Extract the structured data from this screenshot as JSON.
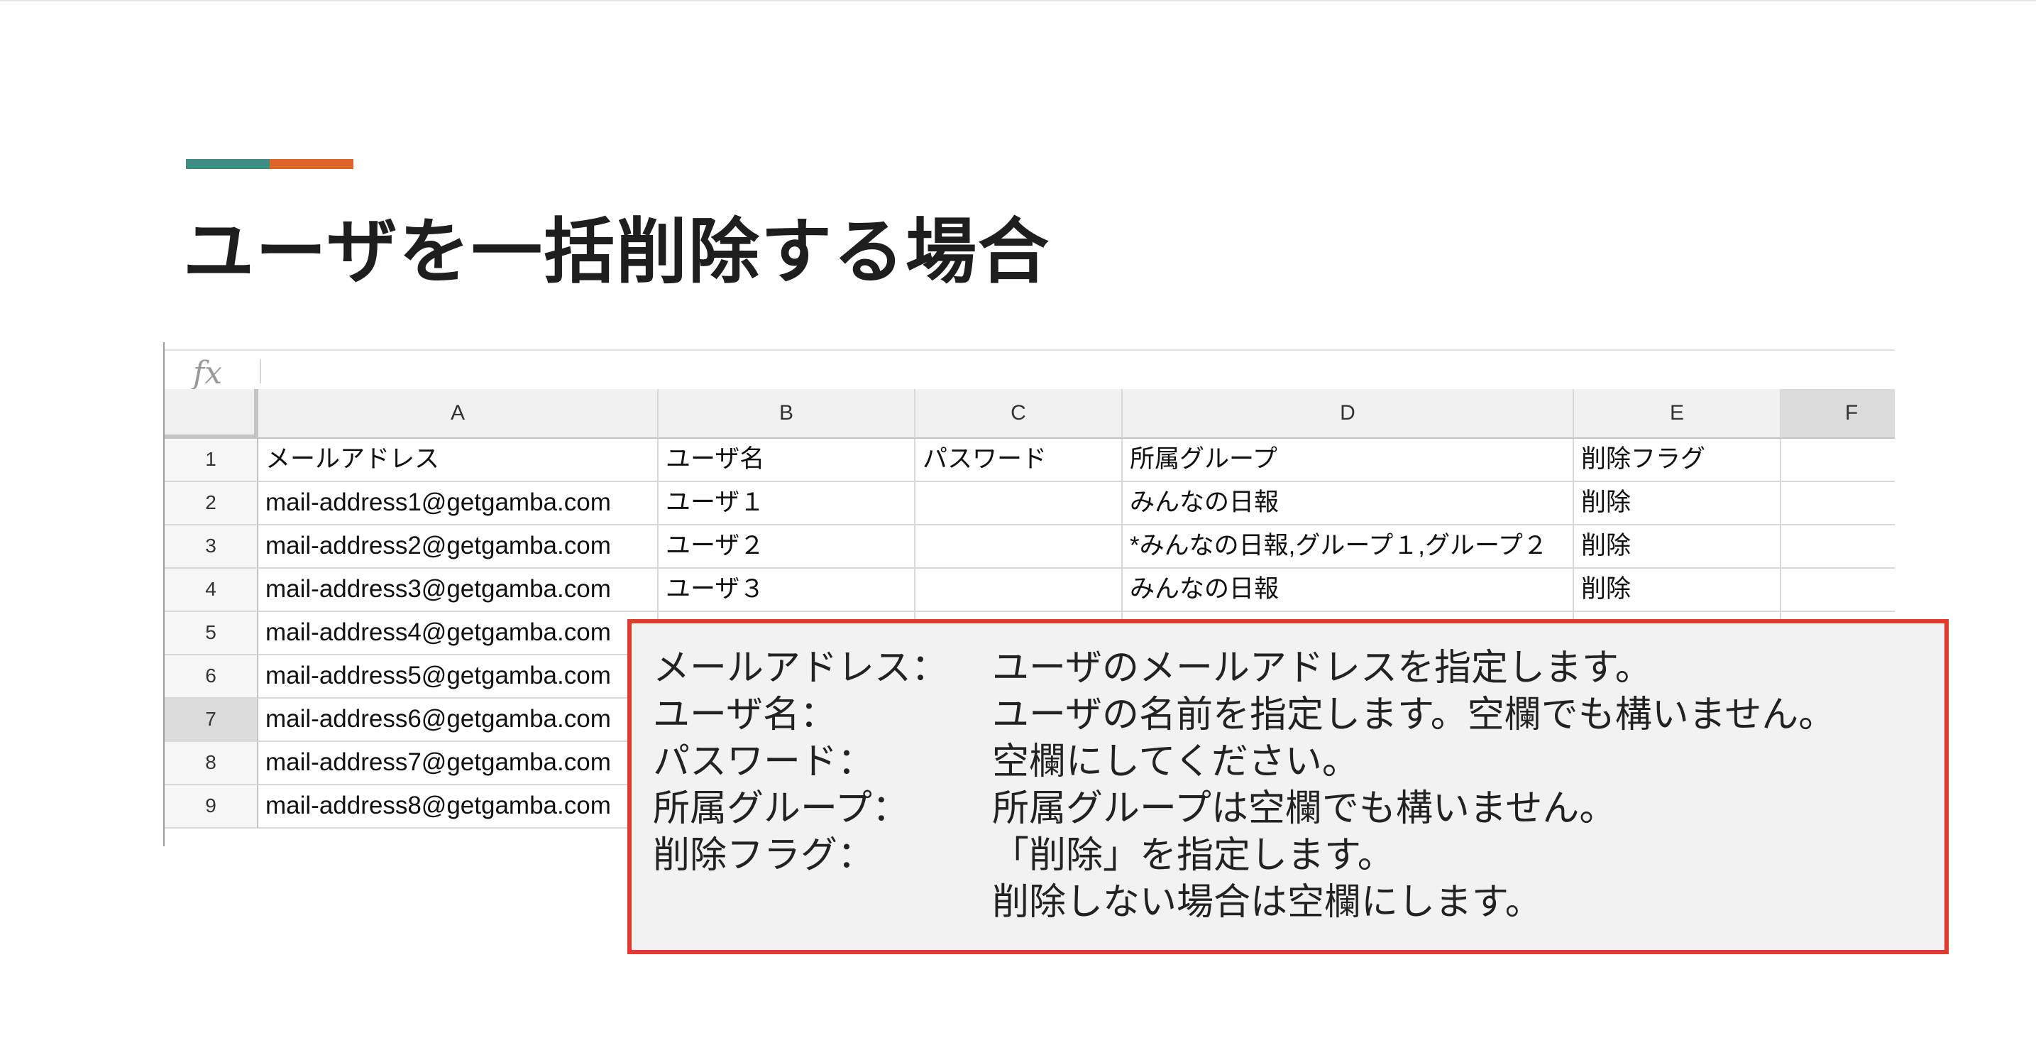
{
  "slide": {
    "title": "ユーザを一括削除する場合",
    "accent_colors": [
      "#3e8c84",
      "#e0632c"
    ]
  },
  "formula_bar": {
    "icon": "fx",
    "value": ""
  },
  "sheet": {
    "columns": [
      "A",
      "B",
      "C",
      "D",
      "E",
      "F"
    ],
    "selected_column": "F",
    "selected_row": 7,
    "rows": [
      {
        "num": "1",
        "cells": [
          "メールアドレス",
          "ユーザ名",
          "パスワード",
          "所属グループ",
          "削除フラグ",
          ""
        ]
      },
      {
        "num": "2",
        "cells": [
          "mail-address1@getgamba.com",
          "ユーザ１",
          "",
          "みんなの日報",
          "削除",
          ""
        ]
      },
      {
        "num": "3",
        "cells": [
          "mail-address2@getgamba.com",
          "ユーザ２",
          "",
          "*みんなの日報,グループ１,グループ２",
          "削除",
          ""
        ]
      },
      {
        "num": "4",
        "cells": [
          "mail-address3@getgamba.com",
          "ユーザ３",
          "",
          "みんなの日報",
          "削除",
          ""
        ]
      },
      {
        "num": "5",
        "cells": [
          "mail-address4@getgamba.com",
          "",
          "",
          "",
          "",
          ""
        ]
      },
      {
        "num": "6",
        "cells": [
          "mail-address5@getgamba.com",
          "",
          "",
          "",
          "",
          ""
        ]
      },
      {
        "num": "7",
        "cells": [
          "mail-address6@getgamba.com",
          "",
          "",
          "",
          "",
          ""
        ]
      },
      {
        "num": "8",
        "cells": [
          "mail-address7@getgamba.com",
          "",
          "",
          "",
          "",
          ""
        ]
      },
      {
        "num": "9",
        "cells": [
          "mail-address8@getgamba.com",
          "",
          "",
          "",
          "",
          ""
        ]
      }
    ]
  },
  "note": {
    "border_color": "#e23a2f",
    "items": [
      {
        "label": "メールアドレス：",
        "text": "ユーザのメールアドレスを指定します。"
      },
      {
        "label": "ユーザ名：",
        "text": "ユーザの名前を指定します。空欄でも構いません。"
      },
      {
        "label": "パスワード：",
        "text": "空欄にしてください。"
      },
      {
        "label": "所属グループ：",
        "text": "所属グループは空欄でも構いません。"
      },
      {
        "label": "削除フラグ：",
        "text": "「削除」を指定します。"
      },
      {
        "label": "",
        "text": "削除しない場合は空欄にします。"
      }
    ]
  }
}
